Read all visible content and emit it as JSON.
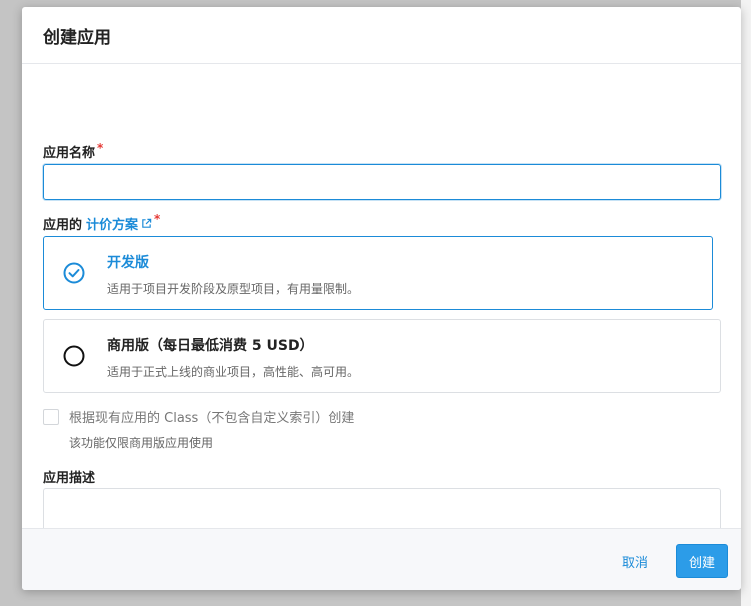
{
  "dialog": {
    "title": "创建应用"
  },
  "form": {
    "name_label": "应用名称",
    "required_mark": "*",
    "name_value": "",
    "name_placeholder": "",
    "plan_label_prefix": "应用的",
    "plan_link": "计价方案",
    "plans": [
      {
        "title": "开发版",
        "description": "适用于项目开发阶段及原型项目，有用量限制。",
        "selected": true
      },
      {
        "title": "商用版（每日最低消费 5 USD）",
        "description": "适用于正式上线的商业项目，高性能、高可用。",
        "selected": false
      }
    ],
    "clone_class_label": "根据现有应用的 Class（不包含自定义索引）创建",
    "clone_class_hint": "该功能仅限商用版应用使用",
    "desc_label": "应用描述",
    "desc_value": ""
  },
  "footer": {
    "cancel_label": "取消",
    "create_label": "创建"
  },
  "colors": {
    "accent": "#1b8bd8",
    "primary_button": "#2c9ce8",
    "required": "#e53935"
  }
}
